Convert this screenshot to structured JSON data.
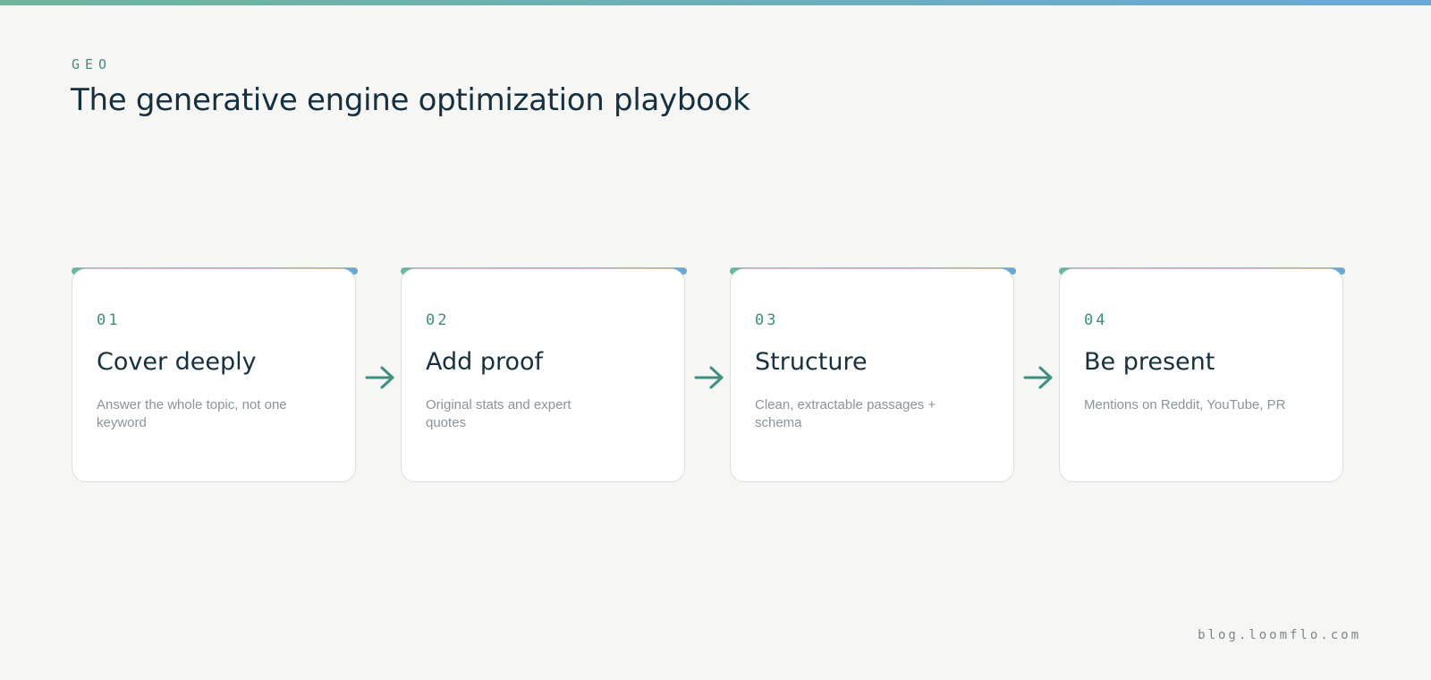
{
  "header": {
    "eyebrow": "GEO",
    "title": "The generative engine optimization playbook"
  },
  "steps": [
    {
      "number": "01",
      "title": "Cover deeply",
      "description": "Answer the whole topic, not one keyword"
    },
    {
      "number": "02",
      "title": "Add proof",
      "description": "Original stats and expert quotes"
    },
    {
      "number": "03",
      "title": "Structure",
      "description": "Clean, extractable passages + schema"
    },
    {
      "number": "04",
      "title": "Be present",
      "description": "Mentions on Reddit, YouTube, PR"
    }
  ],
  "footer": {
    "site": "blog.loomflo.com"
  },
  "colors": {
    "accent_green": "#3f8f7e",
    "gradient_start": "#6fb59c",
    "gradient_end": "#6aa8d8",
    "heading": "#16303f",
    "background": "#f6f6f4"
  },
  "icons": {
    "connector": "arrow-right-icon"
  }
}
